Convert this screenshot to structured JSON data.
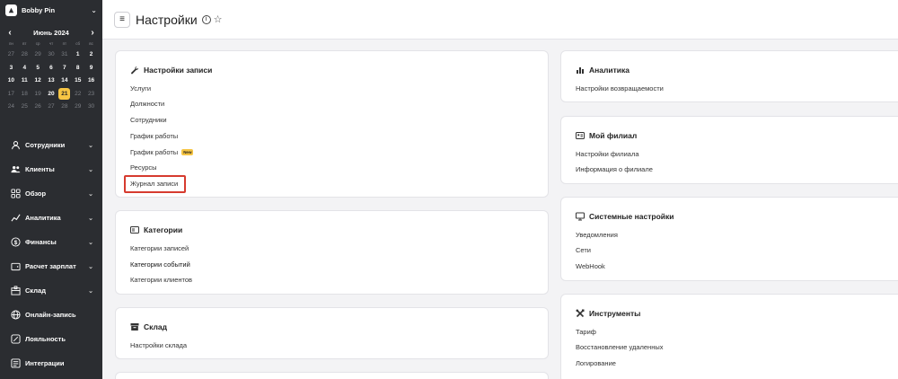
{
  "org": {
    "name": "Bobby Pin"
  },
  "calendar": {
    "month": "Июнь 2024",
    "dow": [
      "пн",
      "вт",
      "ср",
      "чт",
      "пт",
      "сб",
      "вс"
    ],
    "weeks": [
      [
        {
          "d": "27",
          "m": true
        },
        {
          "d": "28",
          "m": true
        },
        {
          "d": "29",
          "m": true
        },
        {
          "d": "30",
          "m": true
        },
        {
          "d": "31",
          "m": true
        },
        {
          "d": "1"
        },
        {
          "d": "2"
        }
      ],
      [
        {
          "d": "3"
        },
        {
          "d": "4"
        },
        {
          "d": "5"
        },
        {
          "d": "6"
        },
        {
          "d": "7"
        },
        {
          "d": "8"
        },
        {
          "d": "9"
        }
      ],
      [
        {
          "d": "10"
        },
        {
          "d": "11"
        },
        {
          "d": "12"
        },
        {
          "d": "13"
        },
        {
          "d": "14"
        },
        {
          "d": "15"
        },
        {
          "d": "16"
        }
      ],
      [
        {
          "d": "17",
          "m": true
        },
        {
          "d": "18",
          "m": true
        },
        {
          "d": "19",
          "m": true
        },
        {
          "d": "20"
        },
        {
          "d": "21",
          "t": true
        },
        {
          "d": "22",
          "m": true
        },
        {
          "d": "23",
          "m": true
        }
      ],
      [
        {
          "d": "24",
          "m": true
        },
        {
          "d": "25",
          "m": true
        },
        {
          "d": "26",
          "m": true
        },
        {
          "d": "27",
          "m": true
        },
        {
          "d": "28",
          "m": true
        },
        {
          "d": "29",
          "m": true
        },
        {
          "d": "30",
          "m": true
        }
      ]
    ]
  },
  "nav": {
    "items": [
      {
        "label": "Сотрудники",
        "icon": "user-icon",
        "chev": true
      },
      {
        "label": "Клиенты",
        "icon": "clients-icon",
        "chev": true
      },
      {
        "label": "Обзор",
        "icon": "grid-icon",
        "chev": true
      },
      {
        "label": "Аналитика",
        "icon": "chart-icon",
        "chev": true
      },
      {
        "label": "Финансы",
        "icon": "dollar-icon",
        "chev": true
      },
      {
        "label": "Расчет зарплат",
        "icon": "wallet-icon",
        "chev": true
      },
      {
        "label": "Склад",
        "icon": "box-icon",
        "chev": true
      },
      {
        "label": "Онлайн-запись",
        "icon": "globe-icon",
        "chev": false
      },
      {
        "label": "Лояльность",
        "icon": "percent-icon",
        "chev": false
      },
      {
        "label": "Интеграции",
        "icon": "integration-icon",
        "chev": false
      }
    ]
  },
  "header": {
    "title": "Настройки"
  },
  "cards": {
    "records": {
      "title": "Настройки записи",
      "links": [
        "Услуги",
        "Должности",
        "Сотрудники",
        "График работы",
        "График работы",
        "Ресурсы",
        "Журнал записи"
      ],
      "badge": "New"
    },
    "categories": {
      "title": "Категории",
      "links": [
        "Категории записей",
        "Категории событий",
        "Категории клиентов"
      ]
    },
    "warehouse": {
      "title": "Склад",
      "links": [
        "Настройки склада"
      ]
    },
    "analytics": {
      "title": "Аналитика",
      "links": [
        "Настройки возвращаемости"
      ]
    },
    "branch": {
      "title": "Мой филиал",
      "links": [
        "Настройки филиала",
        "Информация о филиале"
      ]
    },
    "system": {
      "title": "Системные настройки",
      "links": [
        "Уведомления",
        "Сети",
        "WebHook"
      ]
    },
    "tools": {
      "title": "Инструменты",
      "links": [
        "Тариф",
        "Восстановление удаленных",
        "Логирование"
      ]
    }
  }
}
